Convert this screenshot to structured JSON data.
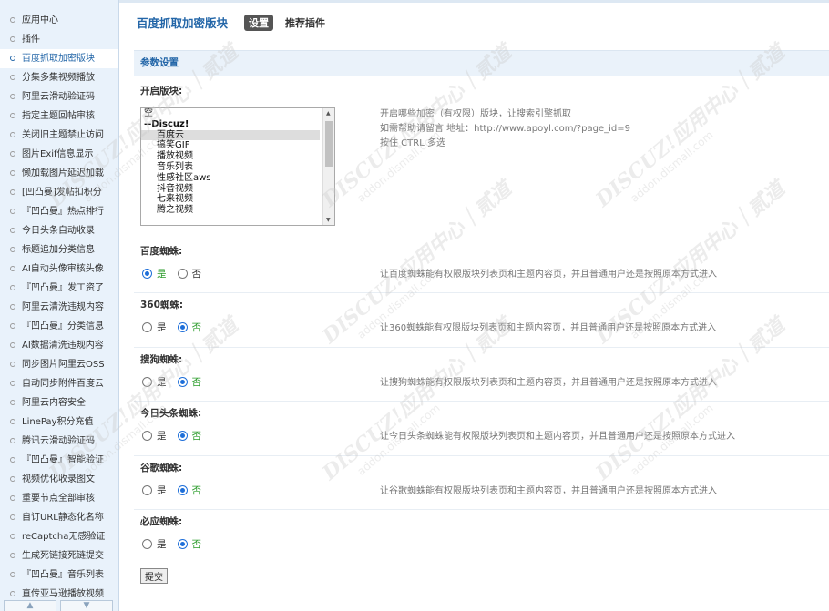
{
  "sidebar": {
    "items": [
      {
        "label": "应用中心"
      },
      {
        "label": "插件"
      },
      {
        "label": "百度抓取加密版块"
      },
      {
        "label": "分集多集视频播放"
      },
      {
        "label": "阿里云滑动验证码"
      },
      {
        "label": "指定主题回帖审核"
      },
      {
        "label": "关闭旧主题禁止访问"
      },
      {
        "label": "图片Exif信息显示"
      },
      {
        "label": "懒加载图片延迟加载"
      },
      {
        "label": "[凹凸曼]发帖扣积分"
      },
      {
        "label": "『凹凸曼』热点排行"
      },
      {
        "label": "今日头条自动收录"
      },
      {
        "label": "标题追加分类信息"
      },
      {
        "label": "AI自动头像审核头像"
      },
      {
        "label": "『凹凸曼』发工资了"
      },
      {
        "label": "阿里云清洗违规内容"
      },
      {
        "label": "『凹凸曼』分类信息"
      },
      {
        "label": "AI数据清洗违规内容"
      },
      {
        "label": "同步图片阿里云OSS"
      },
      {
        "label": "自动同步附件百度云"
      },
      {
        "label": "阿里云内容安全"
      },
      {
        "label": "LinePay积分充值"
      },
      {
        "label": "腾讯云滑动验证码"
      },
      {
        "label": "『凹凸曼』智能验证"
      },
      {
        "label": "视频优化收录图文"
      },
      {
        "label": "重要节点全部审核"
      },
      {
        "label": "自订URL静态化名称"
      },
      {
        "label": "reCaptcha无感验证"
      },
      {
        "label": "生成死链接死链提交"
      },
      {
        "label": "『凹凸曼』音乐列表"
      },
      {
        "label": "直传亚马逊播放视频"
      }
    ],
    "active_index": 2
  },
  "header": {
    "plugin_title": "百度抓取加密版块",
    "tabs": [
      {
        "label": "设置",
        "current": true
      },
      {
        "label": "推荐插件",
        "current": false
      }
    ]
  },
  "section_title": "参数设置",
  "forums_field": {
    "label": "开启版块:",
    "options": [
      {
        "label": "空",
        "type": "plain"
      },
      {
        "label": "--Discuz!",
        "type": "group"
      },
      {
        "label": "百度云",
        "type": "indent",
        "selected": true
      },
      {
        "label": "搞笑GIF",
        "type": "indent"
      },
      {
        "label": "播放视频",
        "type": "indent"
      },
      {
        "label": "音乐列表",
        "type": "indent"
      },
      {
        "label": "性感社区aws",
        "type": "indent"
      },
      {
        "label": "抖音视频",
        "type": "indent"
      },
      {
        "label": "七来视频",
        "type": "indent"
      },
      {
        "label": "腾之视频",
        "type": "indent"
      }
    ],
    "comment_lines": [
      "开启哪些加密（有权限）版块，让搜索引擎抓取",
      "如需帮助请留言 地址：http://www.apoyl.com/?page_id=9",
      "按住 CTRL 多选"
    ]
  },
  "spiders": [
    {
      "label": "百度蜘蛛:",
      "yes": "是",
      "no": "否",
      "value": "yes",
      "comment": "让百度蜘蛛能有权限版块列表页和主题内容页，并且普通用户还是按照原本方式进入"
    },
    {
      "label": "360蜘蛛:",
      "yes": "是",
      "no": "否",
      "value": "no",
      "comment": "让360蜘蛛能有权限版块列表页和主题内容页，并且普通用户还是按照原本方式进入"
    },
    {
      "label": "搜狗蜘蛛:",
      "yes": "是",
      "no": "否",
      "value": "no",
      "comment": "让搜狗蜘蛛能有权限版块列表页和主题内容页，并且普通用户还是按照原本方式进入"
    },
    {
      "label": "今日头条蜘蛛:",
      "yes": "是",
      "no": "否",
      "value": "no",
      "comment": "让今日头条蜘蛛能有权限版块列表页和主题内容页，并且普通用户还是按照原本方式进入"
    },
    {
      "label": "谷歌蜘蛛:",
      "yes": "是",
      "no": "否",
      "value": "no",
      "comment": "让谷歌蜘蛛能有权限版块列表页和主题内容页，并且普通用户还是按照原本方式进入"
    },
    {
      "label": "必应蜘蛛:",
      "yes": "是",
      "no": "否",
      "value": "no",
      "comment": ""
    }
  ],
  "submit_label": "提交",
  "watermark": {
    "line1": "DISCUZ!应用中心｜贰道",
    "line2": "addon.dismall.com"
  },
  "colors": {
    "accent": "#2366a8",
    "radio_on": "#1e6fd9",
    "selected_text": "#2a9b2a"
  }
}
